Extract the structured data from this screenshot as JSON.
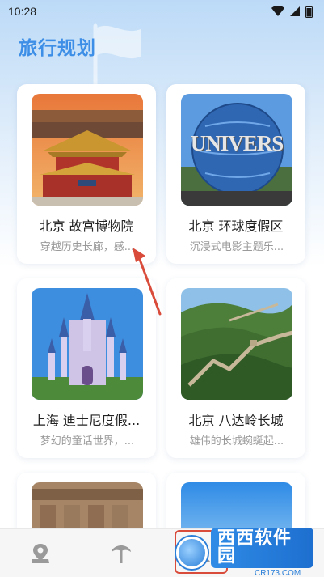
{
  "status_bar": {
    "time": "10:28"
  },
  "page": {
    "title": "旅行规划"
  },
  "cards": [
    {
      "name": "北京 故宫博物院",
      "desc": "穿越历史长廊，感..."
    },
    {
      "name": "北京 环球度假区",
      "desc": "沉浸式电影主题乐..."
    },
    {
      "name": "上海 迪士尼度假...",
      "desc": "梦幻的童话世界，..."
    },
    {
      "name": "北京 八达岭长城",
      "desc": "雄伟的长城蜿蜒起..."
    },
    {
      "name": "",
      "desc": ""
    },
    {
      "name": "",
      "desc": ""
    }
  ],
  "universal_sign": "UNIVERS",
  "tabbar": {
    "items": [
      {
        "icon": "map-pin-icon"
      },
      {
        "icon": "palm-tree-icon"
      },
      {
        "icon": "profile-icon"
      }
    ]
  },
  "watermark": {
    "main": "西西软件园",
    "sub": "CR173.COM"
  },
  "colors": {
    "accent": "#3d8ee6",
    "annotation": "#d94b3a"
  }
}
